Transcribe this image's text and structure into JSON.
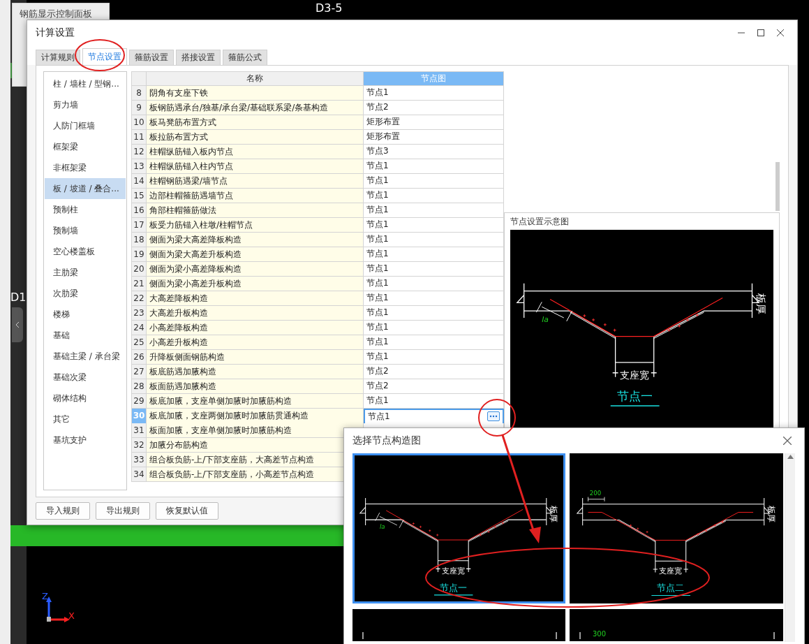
{
  "background": {
    "panel_title": "钢筋显示控制面板",
    "grid_labels": [
      {
        "text": "D3-5",
        "kind": "top"
      },
      {
        "text": "D1",
        "kind": "left"
      }
    ],
    "axis_gizmo": {
      "z": "Z",
      "x": "X"
    }
  },
  "dialog": {
    "title": "计算设置",
    "tabs": [
      {
        "label": "计算规则",
        "selected": false
      },
      {
        "label": "节点设置",
        "selected": true
      },
      {
        "label": "箍筋设置",
        "selected": false
      },
      {
        "label": "搭接设置",
        "selected": false
      },
      {
        "label": "箍筋公式",
        "selected": false
      }
    ],
    "categories": [
      {
        "label": "柱 / 墙柱 / 型钢...",
        "selected": false
      },
      {
        "label": "剪力墙",
        "selected": false
      },
      {
        "label": "人防门框墙",
        "selected": false
      },
      {
        "label": "框架梁",
        "selected": false
      },
      {
        "label": "非框架梁",
        "selected": false
      },
      {
        "label": "板 / 坡道 / 叠合...",
        "selected": true
      },
      {
        "label": "预制柱",
        "selected": false
      },
      {
        "label": "预制墙",
        "selected": false
      },
      {
        "label": "空心楼盖板",
        "selected": false
      },
      {
        "label": "主肋梁",
        "selected": false
      },
      {
        "label": "次肋梁",
        "selected": false
      },
      {
        "label": "楼梯",
        "selected": false
      },
      {
        "label": "基础",
        "selected": false
      },
      {
        "label": "基础主梁 / 承台梁",
        "selected": false
      },
      {
        "label": "基础次梁",
        "selected": false
      },
      {
        "label": "砌体结构",
        "selected": false
      },
      {
        "label": "其它",
        "selected": false
      },
      {
        "label": "基坑支护",
        "selected": false
      }
    ],
    "table": {
      "columns": [
        "名称",
        "节点图"
      ],
      "rows": [
        {
          "index": "8",
          "name": "阴角有支座下铁",
          "value": "节点1",
          "selected": false
        },
        {
          "index": "9",
          "name": "板钢筋遇承台/独基/承台梁/基础联系梁/条基构造",
          "value": "节点2",
          "selected": false
        },
        {
          "index": "10",
          "name": "板马凳筋布置方式",
          "value": "矩形布置",
          "selected": false
        },
        {
          "index": "11",
          "name": "板拉筋布置方式",
          "value": "矩形布置",
          "selected": false
        },
        {
          "index": "12",
          "name": "柱帽纵筋锚入板内节点",
          "value": "节点3",
          "selected": false
        },
        {
          "index": "13",
          "name": "柱帽纵筋锚入柱内节点",
          "value": "节点1",
          "selected": false
        },
        {
          "index": "14",
          "name": "柱帽钢筋遇梁/墙节点",
          "value": "节点1",
          "selected": false
        },
        {
          "index": "15",
          "name": "边部柱帽箍筋遇墙节点",
          "value": "节点1",
          "selected": false
        },
        {
          "index": "16",
          "name": "角部柱帽箍筋做法",
          "value": "节点1",
          "selected": false
        },
        {
          "index": "17",
          "name": "板受力筋锚入柱墩/柱帽节点",
          "value": "节点1",
          "selected": false
        },
        {
          "index": "18",
          "name": "侧面为梁大高差降板构造",
          "value": "节点1",
          "selected": false
        },
        {
          "index": "19",
          "name": "侧面为梁大高差升板构造",
          "value": "节点1",
          "selected": false
        },
        {
          "index": "20",
          "name": "侧面为梁小高差降板构造",
          "value": "节点1",
          "selected": false
        },
        {
          "index": "21",
          "name": "侧面为梁小高差升板构造",
          "value": "节点1",
          "selected": false
        },
        {
          "index": "22",
          "name": "大高差降板构造",
          "value": "节点1",
          "selected": false
        },
        {
          "index": "23",
          "name": "大高差升板构造",
          "value": "节点1",
          "selected": false
        },
        {
          "index": "24",
          "name": "小高差降板构造",
          "value": "节点1",
          "selected": false
        },
        {
          "index": "25",
          "name": "小高差升板构造",
          "value": "节点1",
          "selected": false
        },
        {
          "index": "26",
          "name": "升降板侧面钢筋构造",
          "value": "节点1",
          "selected": false
        },
        {
          "index": "27",
          "name": "板底筋遇加腋构造",
          "value": "节点2",
          "selected": false
        },
        {
          "index": "28",
          "name": "板面筋遇加腋构造",
          "value": "节点2",
          "selected": false
        },
        {
          "index": "29",
          "name": "板底加腋，支座单侧加腋时加腋筋构造",
          "value": "节点1",
          "selected": false
        },
        {
          "index": "30",
          "name": "板底加腋，支座两侧加腋时加腋筋贯通构造",
          "value": "节点1",
          "selected": true
        },
        {
          "index": "31",
          "name": "板面加腋，支座单侧加腋时加腋筋构造",
          "selected": false
        },
        {
          "index": "32",
          "name": "加腋分布筋构造",
          "selected": false
        },
        {
          "index": "33",
          "name": "组合板负筋-上/下部支座筋，大高差节点构造",
          "selected": false
        },
        {
          "index": "34",
          "name": "组合板负筋-上/下部支座筋，小高差节点构造",
          "selected": false
        }
      ]
    },
    "preview": {
      "title": "节点设置示意图",
      "diagram": {
        "kind": "slope",
        "thickness_label": "板厚",
        "anchor_label": "la",
        "support_label": "支座宽",
        "caption": "节点一"
      }
    },
    "buttons": [
      "导入规则",
      "导出规则",
      "恢复默认值"
    ]
  },
  "picker": {
    "title": "选择节点构造图",
    "options": [
      {
        "kind": "slope",
        "thickness_label": "板厚",
        "anchor_label": "la",
        "support_label": "支座宽",
        "caption": "节点一",
        "selected": true
      },
      {
        "kind": "bent",
        "thickness_label": "板厚",
        "dimension": "200",
        "support_label": "支座宽",
        "caption": "节点二",
        "selected": false
      },
      {
        "kind": "cut",
        "selected": false
      },
      {
        "kind": "cut",
        "dimension": "300",
        "selected": false
      }
    ]
  }
}
